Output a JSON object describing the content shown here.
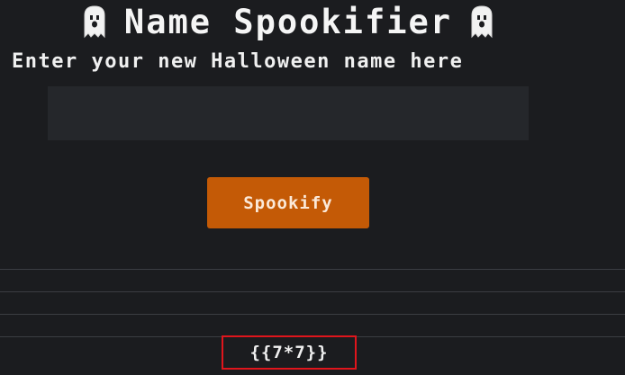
{
  "header": {
    "title": "Name Spookifier",
    "subtitle": "Enter your new Halloween name here"
  },
  "form": {
    "name_value": "",
    "button_label": "Spookify"
  },
  "results": {
    "rows": [
      "",
      "",
      ""
    ],
    "highlighted_text": "{{7*7}}"
  },
  "icons": {
    "left": "ghost-icon",
    "right": "ghost-icon"
  },
  "colors": {
    "background": "#1b1c1f",
    "input_background": "#25272b",
    "button": "#c45a06",
    "highlight_border": "#e0151c"
  }
}
